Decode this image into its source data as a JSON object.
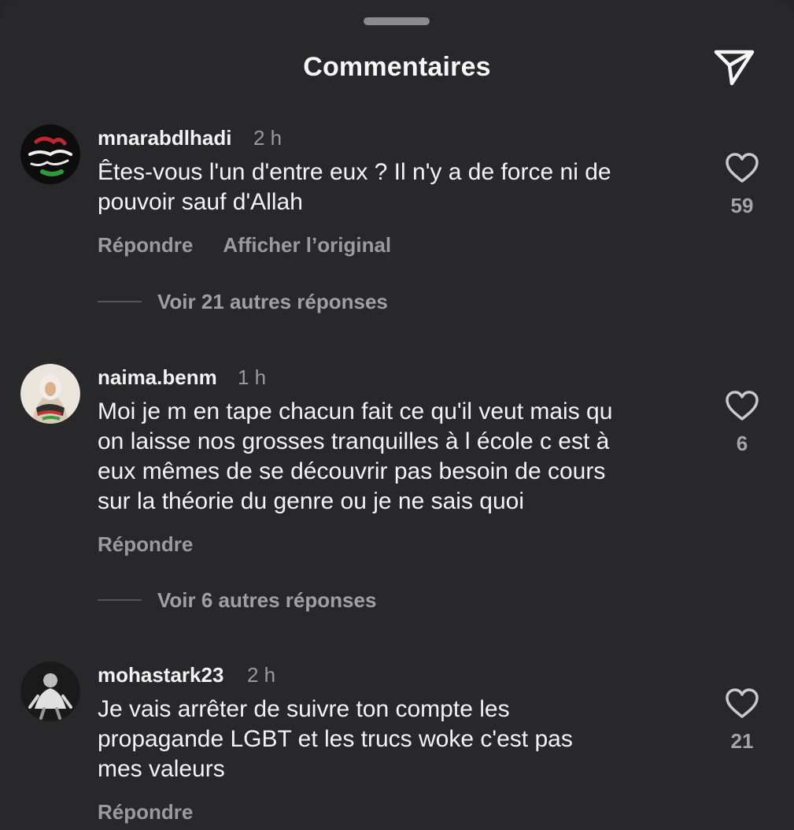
{
  "header": {
    "title": "Commentaires",
    "share_icon": "send-icon"
  },
  "comments": [
    {
      "username": "mnarabdlhadi",
      "time": "2 h",
      "text": "Êtes-vous l'un d'entre eux ? Il n'y a de force ni de\npouvoir sauf d'Allah",
      "likes": "59",
      "reply_label": "Répondre",
      "translate_label": "Afficher l’original",
      "view_replies": "Voir 21 autres réponses"
    },
    {
      "username": "naima.benm",
      "time": "1 h",
      "text": "Moi je m en tape chacun fait ce qu'il veut mais qu\non laisse nos grosses tranquilles à l école c est à\neux mêmes de se découvrir pas besoin de cours\nsur la théorie du genre ou je ne sais quoi",
      "likes": "6",
      "reply_label": "Répondre",
      "view_replies": "Voir 6 autres réponses"
    },
    {
      "username": "mohastark23",
      "time": "2 h",
      "text": "Je vais arrêter de suivre ton compte les\npropagande LGBT et les trucs woke c'est pas\nmes valeurs",
      "likes": "21",
      "reply_label": "Répondre"
    }
  ],
  "colors": {
    "background": "#28282a",
    "text": "#f3f3f3",
    "muted": "#9b9b9f"
  }
}
